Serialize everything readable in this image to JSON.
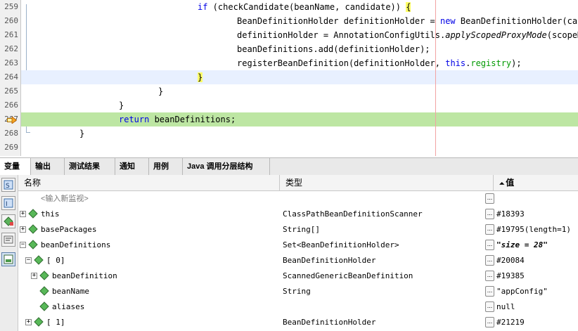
{
  "editor": {
    "lines": [
      {
        "num": "259",
        "indent": 224,
        "parts": [
          {
            "t": "if",
            "c": "kw"
          },
          {
            "t": " (checkCandidate(beanName, candidate)) "
          },
          {
            "t": "{",
            "c": "hl-brace"
          }
        ]
      },
      {
        "num": "260",
        "indent": 280,
        "parts": [
          {
            "t": "BeanDefinitionHolder definitionHolder = "
          },
          {
            "t": "new",
            "c": "kw"
          },
          {
            "t": " BeanDefinitionHolder(candidate, beanName);"
          }
        ]
      },
      {
        "num": "261",
        "indent": 280,
        "parts": [
          {
            "t": "definitionHolder = AnnotationConfigUtils."
          },
          {
            "t": "applyScopedProxyMode",
            "c": "it"
          },
          {
            "t": "(scopeMetadata, definitionHolder, this.registry);"
          }
        ]
      },
      {
        "num": "262",
        "indent": 280,
        "parts": [
          {
            "t": "beanDefinitions.add(definitionHolder);"
          }
        ]
      },
      {
        "num": "263",
        "indent": 280,
        "parts": [
          {
            "t": "registerBeanDefinition(definitionHolder, "
          },
          {
            "t": "this",
            "c": "kw"
          },
          {
            "t": "."
          },
          {
            "t": "registry",
            "c": "fld"
          },
          {
            "t": ");"
          }
        ]
      },
      {
        "num": "264",
        "indent": 224,
        "parts": [
          {
            "t": "}",
            "c": "hl-brace"
          }
        ]
      },
      {
        "num": "265",
        "indent": 168,
        "parts": [
          {
            "t": "}"
          }
        ]
      },
      {
        "num": "266",
        "indent": 112,
        "parts": [
          {
            "t": "}"
          }
        ]
      },
      {
        "num": "267",
        "indent": 112,
        "parts": [
          {
            "t": "return",
            "c": "kw"
          },
          {
            "t": " beanDefinitions;"
          }
        ]
      },
      {
        "num": "268",
        "indent": 56,
        "parts": [
          {
            "t": "}"
          }
        ]
      },
      {
        "num": "269",
        "indent": 0,
        "parts": []
      }
    ]
  },
  "tabs": [
    {
      "label": "变量",
      "close": "⌘",
      "active": true
    },
    {
      "label": "输出"
    },
    {
      "label": "测试结果"
    },
    {
      "label": "通知"
    },
    {
      "label": "用例"
    },
    {
      "label": "Java 调用分层结构"
    }
  ],
  "table": {
    "headers": {
      "name": "名称",
      "type": "类型",
      "value": "值",
      "sort_glyph": "⏶"
    },
    "watch_placeholder": "<输入新监视>",
    "rows": [
      {
        "indent": 0,
        "expander": "+",
        "name": "this",
        "type": "ClassPathBeanDefinitionScanner",
        "value": "#18393",
        "bold": false
      },
      {
        "indent": 0,
        "expander": "+",
        "name": "basePackages",
        "type": "String[]",
        "value": "#19795(length=1)",
        "bold": false
      },
      {
        "indent": 0,
        "expander": "−",
        "name": "beanDefinitions",
        "type": "Set<BeanDefinitionHolder>",
        "value": "\"size = 28\"",
        "bold": true
      },
      {
        "indent": 1,
        "expander": "−",
        "name": "[ 0]",
        "type": "BeanDefinitionHolder",
        "value": "#20084",
        "bold": false
      },
      {
        "indent": 2,
        "expander": "+",
        "name": "beanDefinition",
        "type": "ScannedGenericBeanDefinition",
        "value": "#19385",
        "bold": false
      },
      {
        "indent": 2,
        "expander": "",
        "name": "beanName",
        "type": "String",
        "value": "\"appConfig\"",
        "bold": false
      },
      {
        "indent": 2,
        "expander": "",
        "name": "aliases",
        "type": "",
        "value": "null",
        "bold": false
      },
      {
        "indent": 1,
        "expander": "+",
        "name": "[ 1]",
        "type": "BeanDefinitionHolder",
        "value": "#21219",
        "bold": false
      }
    ],
    "dots_label": "..."
  },
  "colors": {
    "accent": "#3c8c3c",
    "exec_line": "#bde6a3",
    "current_line": "#e8f0ff"
  }
}
